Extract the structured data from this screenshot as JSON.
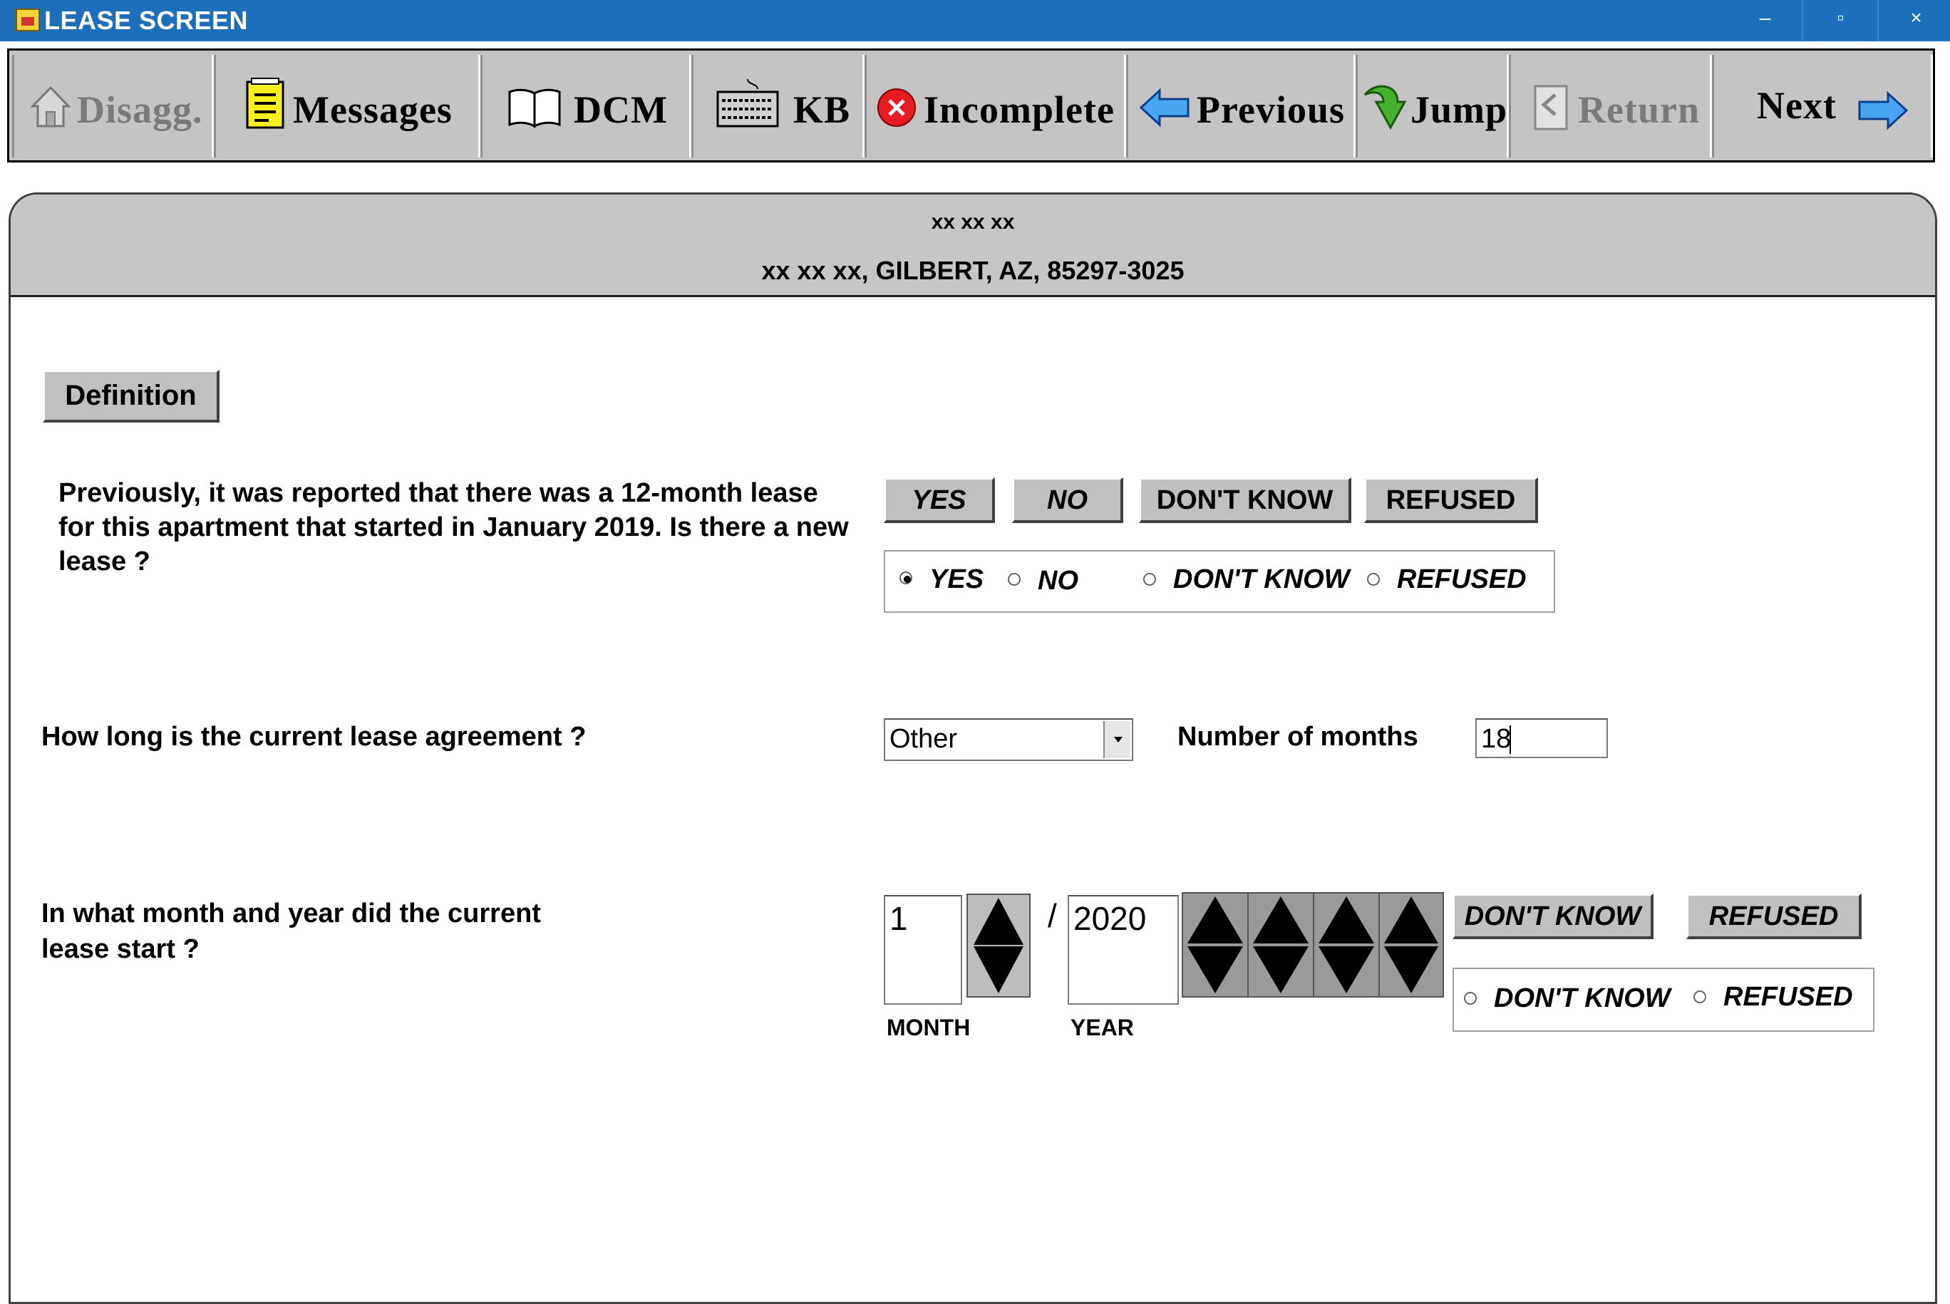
{
  "window": {
    "title": "LEASE SCREEN",
    "minimize": "–",
    "maximize": "▫",
    "close": "×"
  },
  "toolbar": {
    "disagg": "Disagg.",
    "messages": "Messages",
    "dcm": "DCM",
    "kb": "KB",
    "incomplete": "Incomplete",
    "previous": "Previous",
    "jump": "Jump",
    "return": "Return",
    "next": "Next"
  },
  "header": {
    "line1": "xx xx xx",
    "line2": "xx xx xx, GILBERT, AZ, 85297-3025"
  },
  "definition_button": "Definition",
  "q1": {
    "text": "Previously, it was reported that  there was a 12-month lease for this apartment that started in January 2019. Is there a new lease ?",
    "buttons": [
      "YES",
      "NO",
      "DON'T KNOW",
      "REFUSED"
    ],
    "options": [
      "YES",
      "NO",
      "DON'T KNOW",
      "REFUSED"
    ],
    "selected": "YES"
  },
  "q2": {
    "text": "How long is the current lease agreement ?",
    "select_value": "Other",
    "months_label": "Number of months",
    "months_value": "18"
  },
  "q3": {
    "text_line1": "In what month and year did the current",
    "text_line2": "lease start ?",
    "month_value": "1",
    "separator": "/",
    "year_value": "2020",
    "month_label": "MONTH",
    "year_label": "YEAR",
    "buttons": [
      "DON'T KNOW",
      "REFUSED"
    ],
    "options": [
      "DON'T KNOW",
      "REFUSED"
    ]
  }
}
